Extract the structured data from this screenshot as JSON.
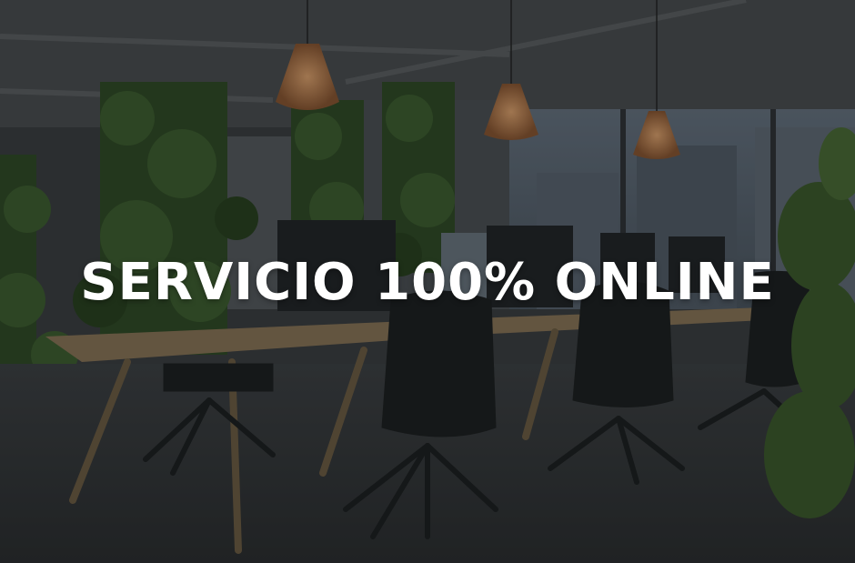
{
  "hero": {
    "headline": "SERVICIO 100% ONLINE",
    "image_subject": "modern-office-with-desks-chairs-plants-and-pendant-lamps"
  },
  "colors": {
    "text": "#ffffff",
    "wood": "#8a7456",
    "plant": "#2f4a24",
    "lamp": "#b2784a"
  }
}
